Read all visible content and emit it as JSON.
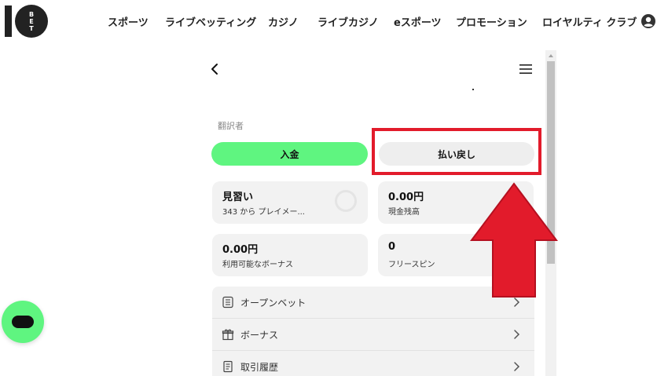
{
  "nav": {
    "items": [
      "スポーツ",
      "ライブベッティング",
      "カジノ",
      "ライブカジノ",
      "eスポーツ",
      "プロモーション",
      "ロイヤルティ クラブ"
    ]
  },
  "panel": {
    "translator_label": "翻訳者",
    "deposit_label": "入金",
    "withdraw_label": "払い戻し"
  },
  "cards": {
    "trainee": {
      "value": "見習い",
      "sub": "343 から プレイメー..."
    },
    "cash_balance": {
      "value": "0.00円",
      "sub": "現金残高"
    },
    "available_bonus": {
      "value": "0.00円",
      "sub": "利用可能なボーナス"
    },
    "free_spins": {
      "value": "0",
      "sub": "フリースピン"
    }
  },
  "menu": {
    "items": [
      "オープンベット",
      "ボーナス",
      "取引履歴"
    ]
  },
  "colors": {
    "accent_green": "#5ff580",
    "highlight_red": "#e21b2b"
  }
}
